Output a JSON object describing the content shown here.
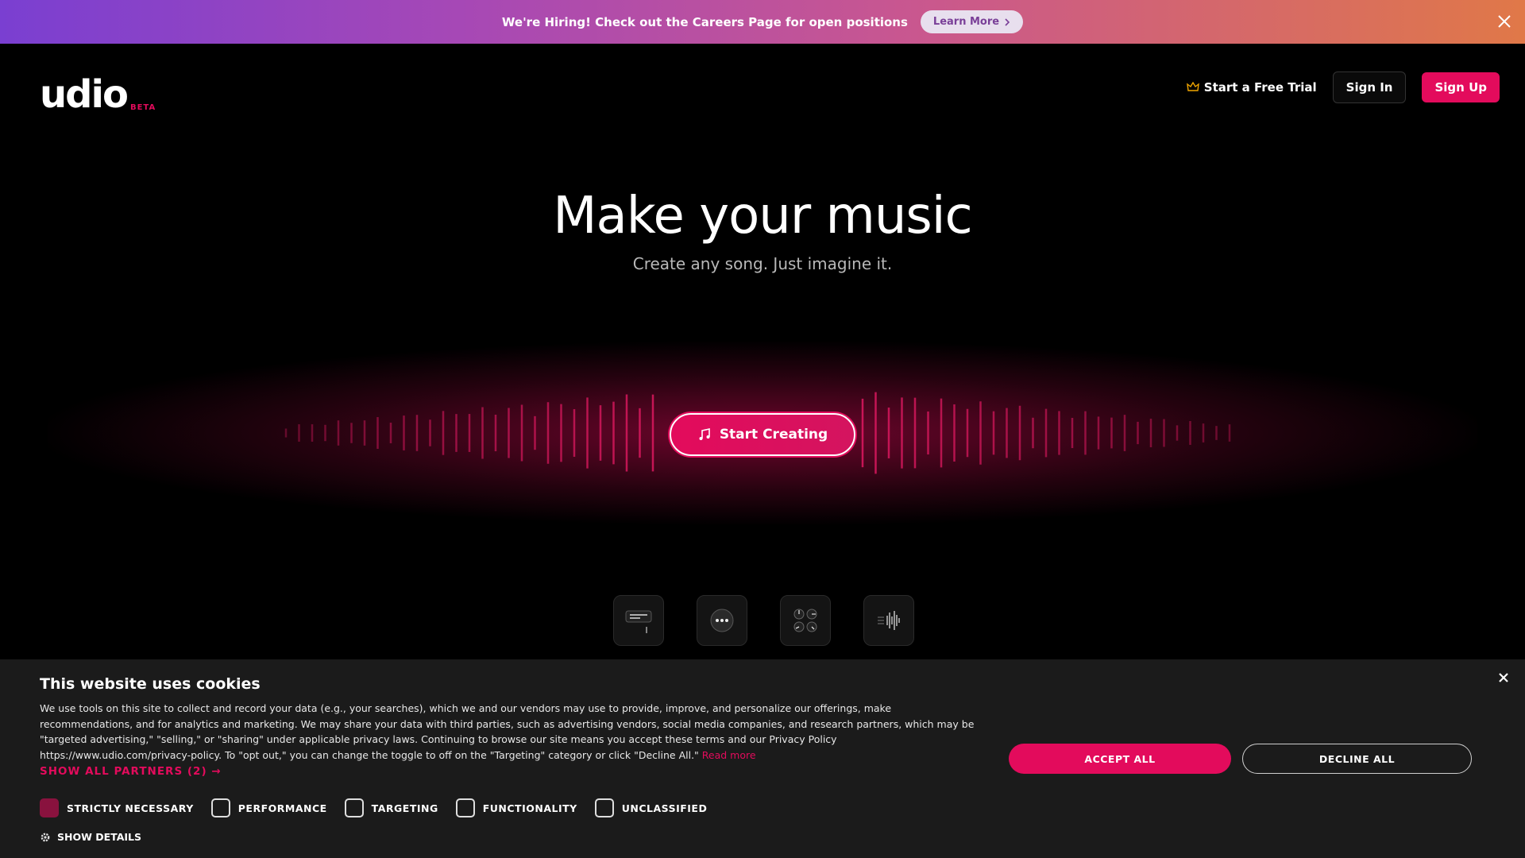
{
  "banner": {
    "text": "We're Hiring! Check out the Careers Page for open positions",
    "button_label": "Learn More"
  },
  "header": {
    "logo_text": "udio",
    "logo_badge": "BETA",
    "trial_label": "Start a Free Trial",
    "signin_label": "Sign In",
    "signup_label": "Sign Up"
  },
  "hero": {
    "title": "Make your music",
    "subtitle": "Create any song. Just imagine it.",
    "cta_label": "Start Creating"
  },
  "features": [
    {
      "icon": "lyrics-editor-icon"
    },
    {
      "icon": "chat-bubble-icon"
    },
    {
      "icon": "mixer-knobs-icon"
    },
    {
      "icon": "waveform-icon"
    }
  ],
  "cookie": {
    "title": "This website uses cookies",
    "body": "We use tools on this site to collect and record your data (e.g., your searches), which we and our vendors may use to provide, improve, and personalize our offerings, make recommendations, and for analytics and marketing. We may share your data with third parties, such as advertising vendors, social media companies, and research partners, which may be \"targeted advertising,\" \"selling,\" or \"sharing\" under applicable privacy laws. Continuing to browse our site means you accept these terms and our Privacy Policy https://www.udio.com/privacy-policy. To \"opt out,\" you can change the toggle to off on the \"Targeting\" category or click \"Decline All.\"",
    "read_more": "Read more",
    "partners_link": "SHOW ALL PARTNERS (2) →",
    "accept_label": "ACCEPT ALL",
    "decline_label": "DECLINE ALL",
    "categories": [
      {
        "label": "STRICTLY NECESSARY",
        "checked": true
      },
      {
        "label": "PERFORMANCE",
        "checked": false
      },
      {
        "label": "TARGETING",
        "checked": false
      },
      {
        "label": "FUNCTIONALITY",
        "checked": false
      },
      {
        "label": "UNCLASSIFIED",
        "checked": false
      }
    ],
    "show_details": "SHOW DETAILS"
  },
  "colors": {
    "accent": "#e30b5c",
    "background": "#000000",
    "cookie_bg": "#1b1b1b"
  }
}
